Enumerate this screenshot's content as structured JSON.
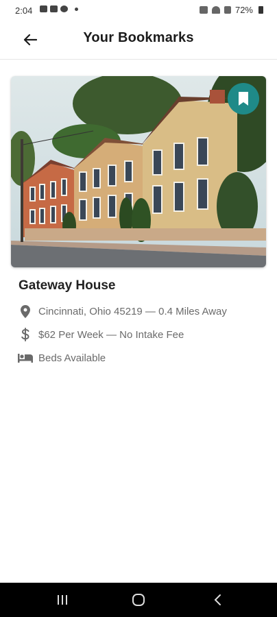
{
  "status_bar": {
    "time": "2:04",
    "battery": "72%"
  },
  "header": {
    "title": "Your Bookmarks",
    "back_icon": "arrow-left-icon"
  },
  "listing": {
    "title": "Gateway House",
    "location": "Cincinnati, Ohio 45219 — 0.4 Miles Away",
    "price": "$62 Per Week — No Intake Fee",
    "beds": "Beds Available",
    "bookmark_icon": "bookmark-icon",
    "accent_color": "#1f8a88"
  }
}
